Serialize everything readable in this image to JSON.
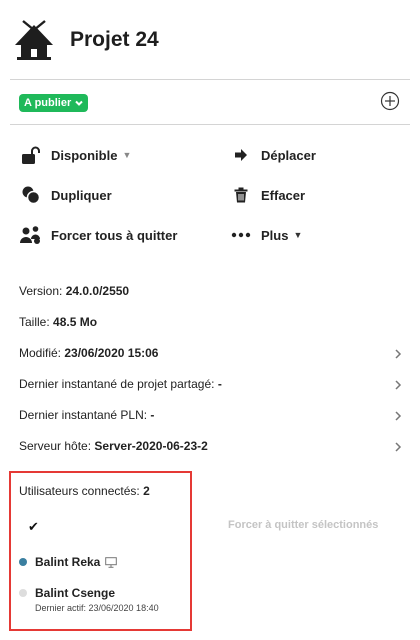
{
  "project": {
    "title": "Projet 24",
    "status_label": "A publier"
  },
  "actions": {
    "availability": "Disponible",
    "move": "Déplacer",
    "duplicate": "Dupliquer",
    "delete": "Effacer",
    "force_quit_all": "Forcer tous à quitter",
    "more": "Plus"
  },
  "info": {
    "version_label": "Version:",
    "version_value": "24.0.0/2550",
    "size_label": "Taille:",
    "size_value": "48.5 Mo",
    "modified_label": "Modifié:",
    "modified_value": "23/06/2020 15:06",
    "snapshot_shared_label": "Dernier instantané de projet partagé:",
    "snapshot_shared_value": "-",
    "snapshot_pln_label": "Dernier instantané PLN:",
    "snapshot_pln_value": "-",
    "host_label": "Serveur hôte:",
    "host_value": "Server-2020-06-23-2"
  },
  "users": {
    "connected_label": "Utilisateurs connectés:",
    "connected_count": "2",
    "force_quit_selected": "Forcer à quitter sélectionnés",
    "list": [
      {
        "name": "Balint Reka",
        "status_color": "#3a7fa0"
      },
      {
        "name": "Balint Csenge",
        "status_color": "#dddddd",
        "last_active": "Dernier actif: 23/06/2020 18:40"
      }
    ]
  },
  "colors": {
    "status_green": "#1fb95a",
    "highlight_red": "#e53935"
  }
}
